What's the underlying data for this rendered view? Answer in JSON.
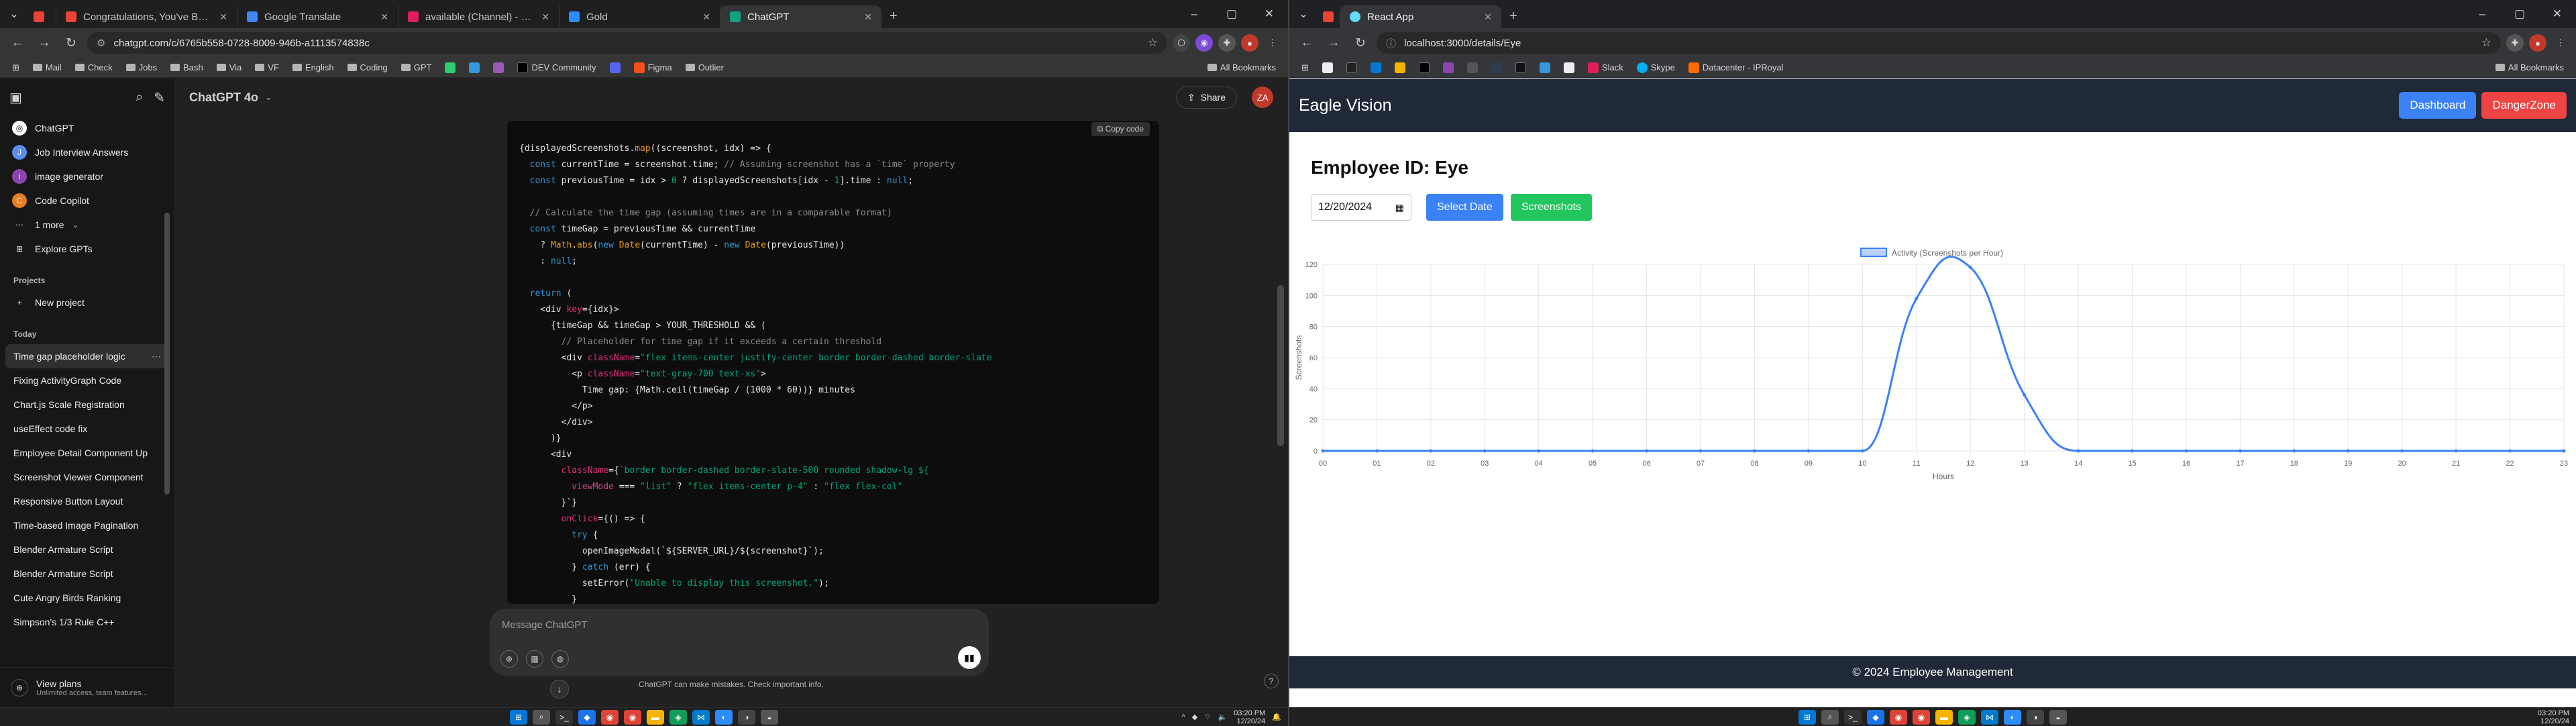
{
  "left_browser": {
    "tabs": [
      {
        "label": "",
        "fav": "#ea4335"
      },
      {
        "label": "Congratulations, You've Been",
        "fav": "#ea4335"
      },
      {
        "label": "Google Translate",
        "fav": "#4285f4"
      },
      {
        "label": "available (Channel) - Magenta",
        "fav": "#e01e5a"
      },
      {
        "label": "Gold",
        "fav": "#2d8cff"
      },
      {
        "label": "ChatGPT",
        "fav": "#10a37f",
        "active": true
      }
    ],
    "url": "chatgpt.com/c/6765b558-0728-8009-946b-a1113574838c",
    "bookmarks": [
      "Mail",
      "Check",
      "Jobs",
      "Bash",
      "Via",
      "VF",
      "English",
      "Coding",
      "GPT",
      "DEV Community",
      "Figma",
      "Outlier"
    ],
    "all_bookmarks": "All Bookmarks"
  },
  "sidebar": {
    "top_items": [
      {
        "label": "ChatGPT",
        "icon": "chatgpt-logo-icon",
        "color": "#ffffff"
      },
      {
        "label": "Job Interview Answers",
        "icon": "gpt-avatar-icon",
        "color": "#5b8def"
      },
      {
        "label": "image generator",
        "icon": "gpt-avatar-icon",
        "color": "#8e44ad"
      },
      {
        "label": "Code Copilot",
        "icon": "gpt-avatar-icon",
        "color": "#e67e22"
      },
      {
        "label": "1 more",
        "icon": "more-icon",
        "color": "#888888"
      },
      {
        "label": "Explore GPTs",
        "icon": "grid-icon",
        "color": "#888888"
      }
    ],
    "projects_heading": "Projects",
    "new_project": "New project",
    "today_heading": "Today",
    "conversations": [
      "Time gap placeholder logic",
      "Fixing ActivityGraph Code",
      "Chart.js Scale Registration",
      "useEffect code fix",
      "Employee Detail Component Up",
      "Screenshot Viewer Component",
      "Responsive Button Layout",
      "Time-based Image Pagination",
      "Blender Armature Script",
      "Blender Armature Script",
      "Cute Angry Birds Ranking",
      "Simpson's 1/3 Rule C++"
    ],
    "view_plans": "View plans",
    "view_plans_sub": "Unlimited access, team features..."
  },
  "chat": {
    "model": "ChatGPT 4o",
    "share": "Share",
    "avatar": "ZA",
    "copy_code": "Copy code",
    "composer_placeholder": "Message ChatGPT",
    "disclaimer": "ChatGPT can make mistakes. Check important info."
  },
  "right_browser": {
    "tab_label": "React App",
    "url": "localhost:3000/details/Eye",
    "bookmarks": [
      "Slack",
      "Skype",
      "Datacenter - IPRoyal"
    ],
    "all_bookmarks": "All Bookmarks"
  },
  "app": {
    "brand": "Eagle Vision",
    "nav_dashboard": "Dashboard",
    "nav_dangerzone": "DangerZone",
    "employee_title": "Employee ID: Eye",
    "date_value": "12/20/2024",
    "select_date": "Select Date",
    "screenshots": "Screenshots",
    "footer": "© 2024 Employee Management"
  },
  "chart_data": {
    "type": "line",
    "legend": "Activity (Screenshots per Hour)",
    "xlabel": "Hours",
    "ylabel": "Screenshots",
    "x": [
      "00",
      "01",
      "02",
      "03",
      "04",
      "05",
      "06",
      "07",
      "08",
      "09",
      "10",
      "11",
      "12",
      "13",
      "14",
      "15",
      "16",
      "17",
      "18",
      "19",
      "20",
      "21",
      "22",
      "23"
    ],
    "values": [
      0,
      0,
      0,
      0,
      0,
      0,
      0,
      0,
      0,
      0,
      0,
      98,
      118,
      36,
      0,
      0,
      0,
      0,
      0,
      0,
      0,
      0,
      0,
      0
    ],
    "ylim": [
      0,
      120
    ],
    "yticks": [
      0,
      20,
      40,
      60,
      80,
      100,
      120
    ],
    "color": "#3b82f6"
  },
  "taskbar": {
    "time": "03:20 PM",
    "date": "12/20/24"
  }
}
